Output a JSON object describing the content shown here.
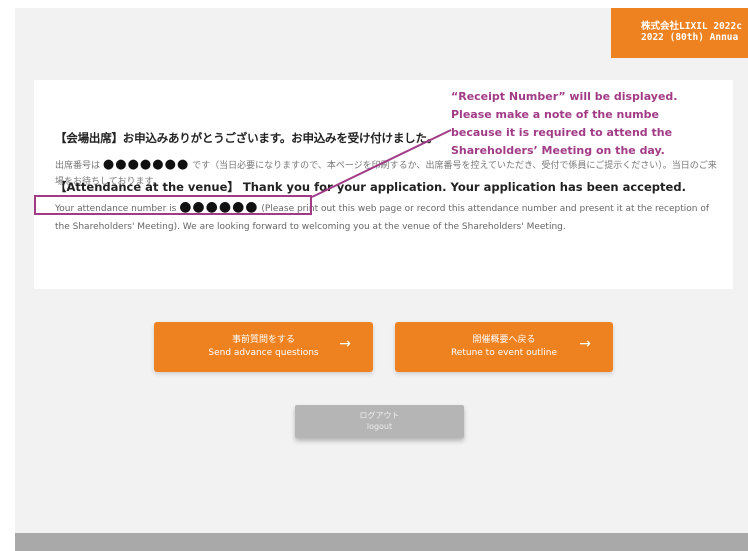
{
  "header": {
    "company_line1": "株式会社LIXIL 2022c",
    "company_line2": "2022 (80th) Annua"
  },
  "confirmation": {
    "jp_heading": "【会場出席】お申込みありがとうございます。お申込みを受け付けました。",
    "jp_body_prefix": "出席番号は",
    "jp_number_mask": "●●●●●●●",
    "jp_body_suffix": "です（当日必要になりますので、本ページを印刷するか、出席番号を控えていただき、受付で係員にご提示ください）。当日のご来場をお待ちしております。",
    "en_heading": "【Attendance at the venue】 Thank you for your application. Your application has been accepted.",
    "en_body_prefix": "Your attendance number is",
    "en_number_mask": "●●●●●●",
    "en_body_suffix": "(Please print out this web page or record this attendance number and present it at the reception of the Shareholders' Meeting). We are looking forward to welcoming you at the venue of the Shareholders' Meeting."
  },
  "annotation": {
    "line1": "“Receipt Number” will be displayed.",
    "line2": "Please make a note of the numbe",
    "line3": "because it is required to attend the",
    "line4": "Shareholders’ Meeting on the day."
  },
  "buttons": {
    "advance_jp": "事前質問をする",
    "advance_en": "Send advance questions",
    "return_jp": "開催概要へ戻る",
    "return_en": "Retune to event outline",
    "arrow": "→",
    "logout_jp": "ログアウト",
    "logout_en": "logout"
  },
  "colors": {
    "accent_orange": "#ef8220",
    "annotation_purple": "#a23b86",
    "logout_gray": "#b5b5b5"
  }
}
